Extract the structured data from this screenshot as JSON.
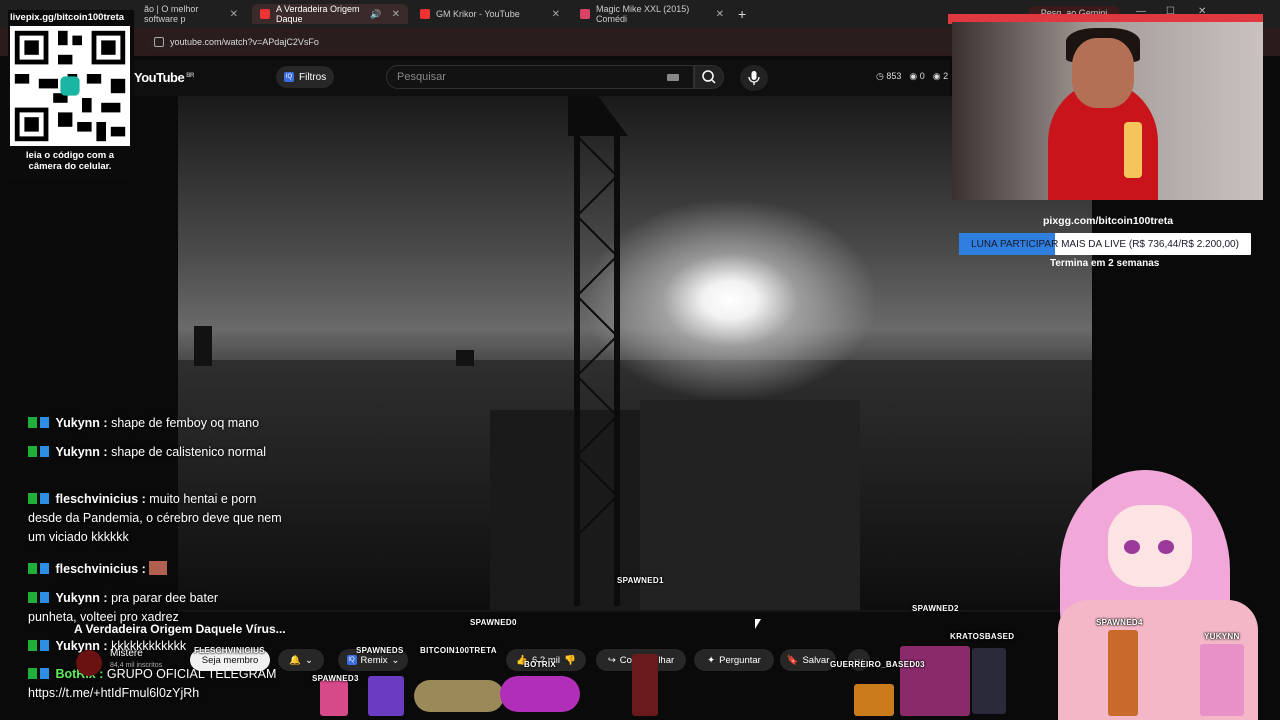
{
  "browser": {
    "tabs": [
      {
        "title": "ão | O melhor software p",
        "active": false
      },
      {
        "title": "A Verdadeira Origem Daque",
        "active": true
      },
      {
        "title": "GM Krikor - YouTube",
        "active": false
      },
      {
        "title": "Magic Mike XXL (2015) Comédi",
        "active": false
      }
    ],
    "url": "youtube.com/watch?v=APdajC2VsFo",
    "gemini_label": "Pesq. ao Gemini"
  },
  "youtube": {
    "logo": "YouTube",
    "region": "BR",
    "filters_label": "Filtros",
    "search_placeholder": "Pesquisar",
    "stats": {
      "a": "853",
      "b": "0",
      "c": "2"
    }
  },
  "overlay_qr": {
    "top_text": "livepix.gg/bitcoin100treta",
    "caption": "leia o código com a câmera do celular."
  },
  "chat": [
    {
      "user": "Yukynn",
      "msg": "shape de femboy oq mano"
    },
    {
      "user": "Yukynn",
      "msg": "shape de calistenico normal"
    },
    {
      "user": "fleschvinicius",
      "msg": "muito hentai e porn desde da Pandemia, o cérebro deve que nem um viciado kkkkkk"
    },
    {
      "user": "fleschvinicius",
      "msg": ""
    },
    {
      "user": "Yukynn",
      "msg": "pra parar dee bater punheta, volteei pro xadrez"
    },
    {
      "user": "Yukynn",
      "msg": "kkkkkkkkkkkk"
    },
    {
      "user": "BotRix",
      "msg": "GRUPO OFICIAL TELEGRAM https://t.me/+htIdFmul6l0zYjRh"
    }
  ],
  "goal": {
    "url": "pixgg.com/bitcoin100treta",
    "label": "LUNA PARTICIPAR MAIS DA LIVE (R$ 736,44/R$ 2.200,00)",
    "current": 736.44,
    "target": 2200.0,
    "progress": 0.33,
    "ends": "Termina em 2 semanas",
    "fill_color": "#2f7fe0"
  },
  "video_info": {
    "title": "A Verdadeira Origem Daquele Vírus...",
    "channel": "Mistere",
    "subs": "84,4 mil inscritos",
    "member_btn": "Seja membro",
    "remix_btn": "Remix",
    "likes": "6,2 mil",
    "share_btn": "Compartilhar",
    "ask_btn": "Perguntar",
    "save_btn": "Salvar"
  },
  "sprites": {
    "labels": [
      "SPAWNED1",
      "SPAWNED0",
      "SPAWNED2",
      "SPAWNED4",
      "YUKYNN",
      "KRATOSBASED",
      "SPAWNEDS",
      "BITCOIN100TRETA",
      "BOTRIX",
      "GUERREIRO_BASED03",
      "FLESCHVINICIUS",
      "SPAWNED3"
    ]
  }
}
